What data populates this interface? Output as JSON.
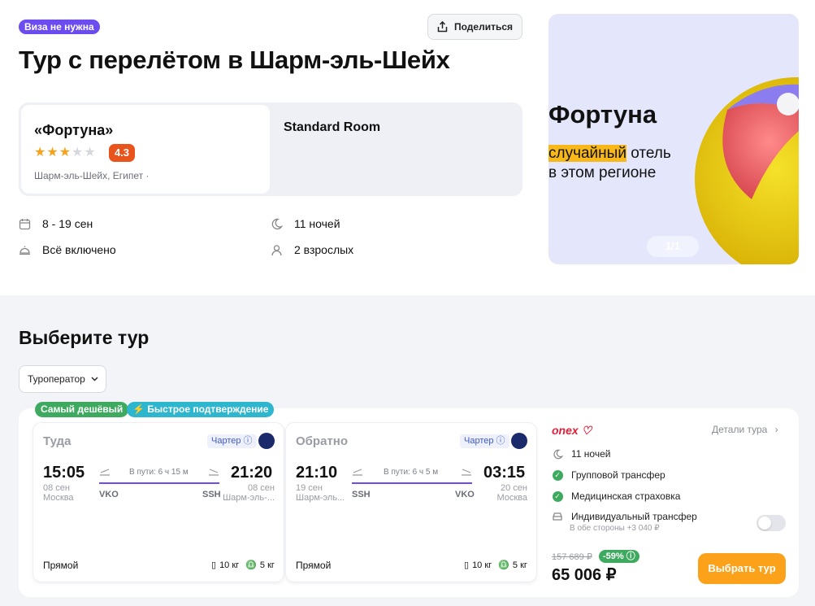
{
  "header": {
    "visa_badge": "Виза не нужна",
    "share_label": "Поделиться",
    "title": "Тур с перелётом в Шарм-эль-Шейх"
  },
  "hotel": {
    "name": "«Фортуна»",
    "stars": 3,
    "stars_max": 5,
    "rating": "4.3",
    "location": "Шарм-эль-Шейх, Египет ·",
    "room": "Standard Room"
  },
  "trip_info": {
    "dates": "8 - 19 сен",
    "nights": "11 ночей",
    "meal": "Всё включено",
    "guests": "2 взрослых"
  },
  "promo": {
    "title": "Фортуна",
    "highlight": "случайный",
    "line1_rest": " отель",
    "line2": "в этом регионе",
    "pager": "1/1"
  },
  "section": {
    "title": "Выберите тур",
    "operator_filter": "Туроператор"
  },
  "tags": {
    "cheapest": "Самый дешёвый",
    "fast": "⚡ Быстрое подтверждение"
  },
  "flights": [
    {
      "heading": "Туда",
      "charter": "Чартер ⓘ",
      "dep_time": "15:05",
      "dep_date": "08 сен",
      "dep_city": "Москва",
      "dep_code": "VKO",
      "duration": "В пути: 6 ч 15 м",
      "arr_time": "21:20",
      "arr_date": "08 сен",
      "arr_city": "Шарм-эль-...",
      "arr_code": "SSH",
      "type": "Прямой",
      "bag1": "10 кг",
      "bag2": "5 кг"
    },
    {
      "heading": "Обратно",
      "charter": "Чартер ⓘ",
      "dep_time": "21:10",
      "dep_date": "19 сен",
      "dep_city": "Шарм-эль...",
      "dep_code": "SSH",
      "duration": "В пути: 6 ч 5 м",
      "arr_time": "03:15",
      "arr_date": "20 сен",
      "arr_city": "Москва",
      "arr_code": "VKO",
      "type": "Прямой",
      "bag1": "10 кг",
      "bag2": "5 кг"
    }
  ],
  "offer": {
    "operator": "onex ♡",
    "details": "Детали тура",
    "nights": "11 ночей",
    "f1": "Групповой трансфер",
    "f2": "Медицинская страховка",
    "f3": "Индивидуальный трансфер",
    "f3_sub": "В обе стороны +3 040 ₽",
    "old_price": "157 689 ₽",
    "discount": "-59% ⓘ",
    "price": "65 006 ₽",
    "buy": "Выбрать тур",
    "accent": "#fba21a"
  }
}
